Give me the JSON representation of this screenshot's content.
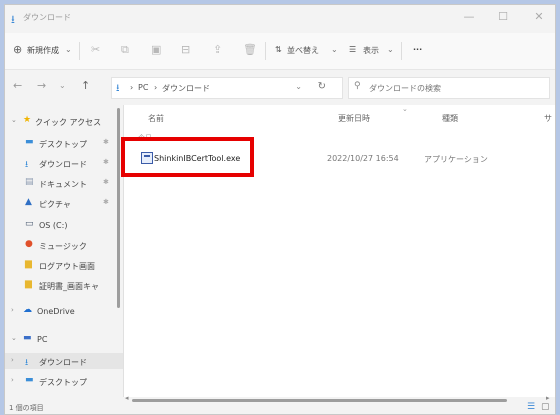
{
  "window": {
    "title": "ダウンロード",
    "controls": {
      "minimize": "—",
      "maximize": "☐",
      "close": "✕"
    }
  },
  "toolbar": {
    "new_label": "新規作成",
    "new_icon": "⊕",
    "sort_label": "並べ替え",
    "sort_icon": "⇅",
    "view_label": "表示",
    "view_icon": "☰",
    "more_label": "···",
    "dropdown_caret": "⌄"
  },
  "address": {
    "back": "←",
    "forward": "→",
    "up": "↑",
    "path": [
      "PC",
      "ダウンロード"
    ],
    "separator": "›",
    "dropdown": "⌄",
    "refresh": "↻"
  },
  "search": {
    "placeholder": "ダウンロードの検索",
    "icon": "⚲"
  },
  "nav_pane": {
    "quick_access": "クイック アクセス",
    "items": [
      {
        "label": "デスクトップ",
        "pin": "📌",
        "color": "#3b8ed8"
      },
      {
        "label": "ダウンロード",
        "pin": "📌",
        "color": "#3b8ed8"
      },
      {
        "label": "ドキュメント",
        "pin": "📌",
        "color": "#8c9bb0"
      },
      {
        "label": "ピクチャ",
        "pin": "📌",
        "color": "#2f6fc4"
      },
      {
        "label": "OS (C:)",
        "pin": "",
        "color": "#4a5a70"
      },
      {
        "label": "ミュージック",
        "pin": "",
        "color": "#e0502a"
      },
      {
        "label": "ログアウト画面",
        "pin": "",
        "color": "#e8b730"
      },
      {
        "label": "証明書_画面キャ",
        "pin": "",
        "color": "#e8b730"
      }
    ],
    "onedrive": "OneDrive",
    "pc": "PC",
    "pc_children": [
      {
        "label": "ダウンロード",
        "color": "#3b8ed8"
      },
      {
        "label": "デスクトップ",
        "color": "#3b8ed8"
      }
    ]
  },
  "columns": {
    "name": "名前",
    "date": "更新日時",
    "type": "種類",
    "size": "サ"
  },
  "group_header": "今日",
  "files": [
    {
      "name": "ShinkinIBCertTool.exe",
      "date": "2022/10/27 16:54",
      "type": "アプリケーション"
    }
  ],
  "status": {
    "count": "1 個の項目"
  }
}
